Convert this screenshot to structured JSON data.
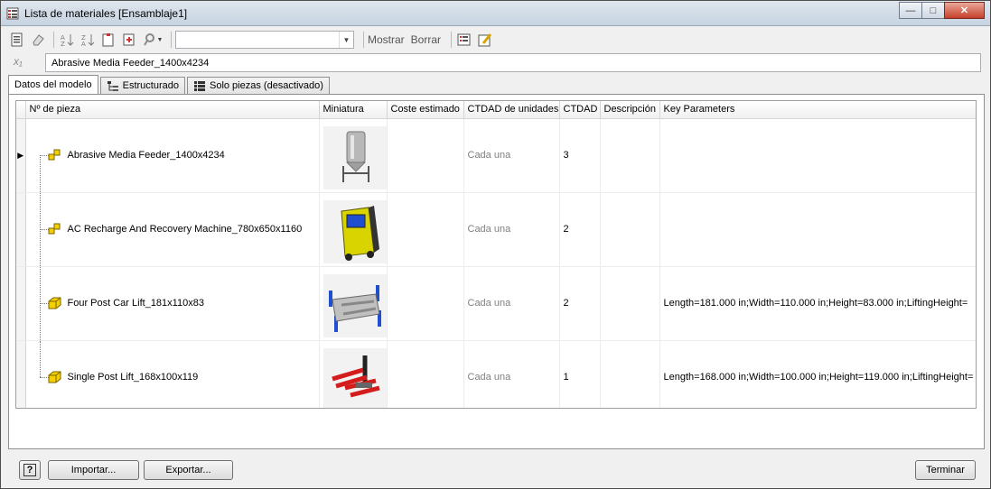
{
  "window": {
    "title": "Lista de materiales [Ensamblaje1]",
    "minimize_label": "—",
    "maximize_label": "□",
    "close_label": "✕"
  },
  "toolbar": {
    "show_label": "Mostrar",
    "clear_label": "Borrar",
    "combo_value": ""
  },
  "formula": {
    "value": "Abrasive Media Feeder_1400x4234"
  },
  "tabs": [
    {
      "label": "Datos del modelo"
    },
    {
      "label": "Estructurado"
    },
    {
      "label": "Solo piezas (desactivado)"
    }
  ],
  "table": {
    "columns": [
      "Nº de pieza",
      "Miniatura",
      "Coste estimado",
      "CTDAD de unidades",
      "CTDAD",
      "Descripción",
      "Key Parameters"
    ],
    "rows": [
      {
        "part": "Abrasive Media Feeder_1400x4234",
        "cost": "",
        "unit_qty": "Cada una",
        "qty": "3",
        "description": "",
        "key_parameters": "",
        "icon": "subassembly-icon",
        "thumb": "hopper-thumbnail"
      },
      {
        "part": "AC Recharge And Recovery Machine_780x650x1160",
        "cost": "",
        "unit_qty": "Cada una",
        "qty": "2",
        "description": "",
        "key_parameters": "",
        "icon": "subassembly-icon",
        "thumb": "ac-machine-thumbnail"
      },
      {
        "part": "Four Post Car Lift_181x110x83",
        "cost": "",
        "unit_qty": "Cada una",
        "qty": "2",
        "description": "",
        "key_parameters": "Length=181.000 in;Width=110.000 in;Height=83.000 in;LiftingHeight=",
        "icon": "part-icon",
        "thumb": "four-post-lift-thumbnail"
      },
      {
        "part": "Single Post Lift_168x100x119",
        "cost": "",
        "unit_qty": "Cada una",
        "qty": "1",
        "description": "",
        "key_parameters": "Length=168.000 in;Width=100.000 in;Height=119.000 in;LiftingHeight=",
        "icon": "part-icon",
        "thumb": "single-post-lift-thumbnail"
      }
    ]
  },
  "footer": {
    "help_label": "?",
    "import_label": "Importar...",
    "export_label": "Exportar...",
    "finish_label": "Terminar"
  },
  "colors": {
    "accent": "#f5d000",
    "lift_blue": "#1f4fcf",
    "lift_red": "#d41c1c"
  }
}
